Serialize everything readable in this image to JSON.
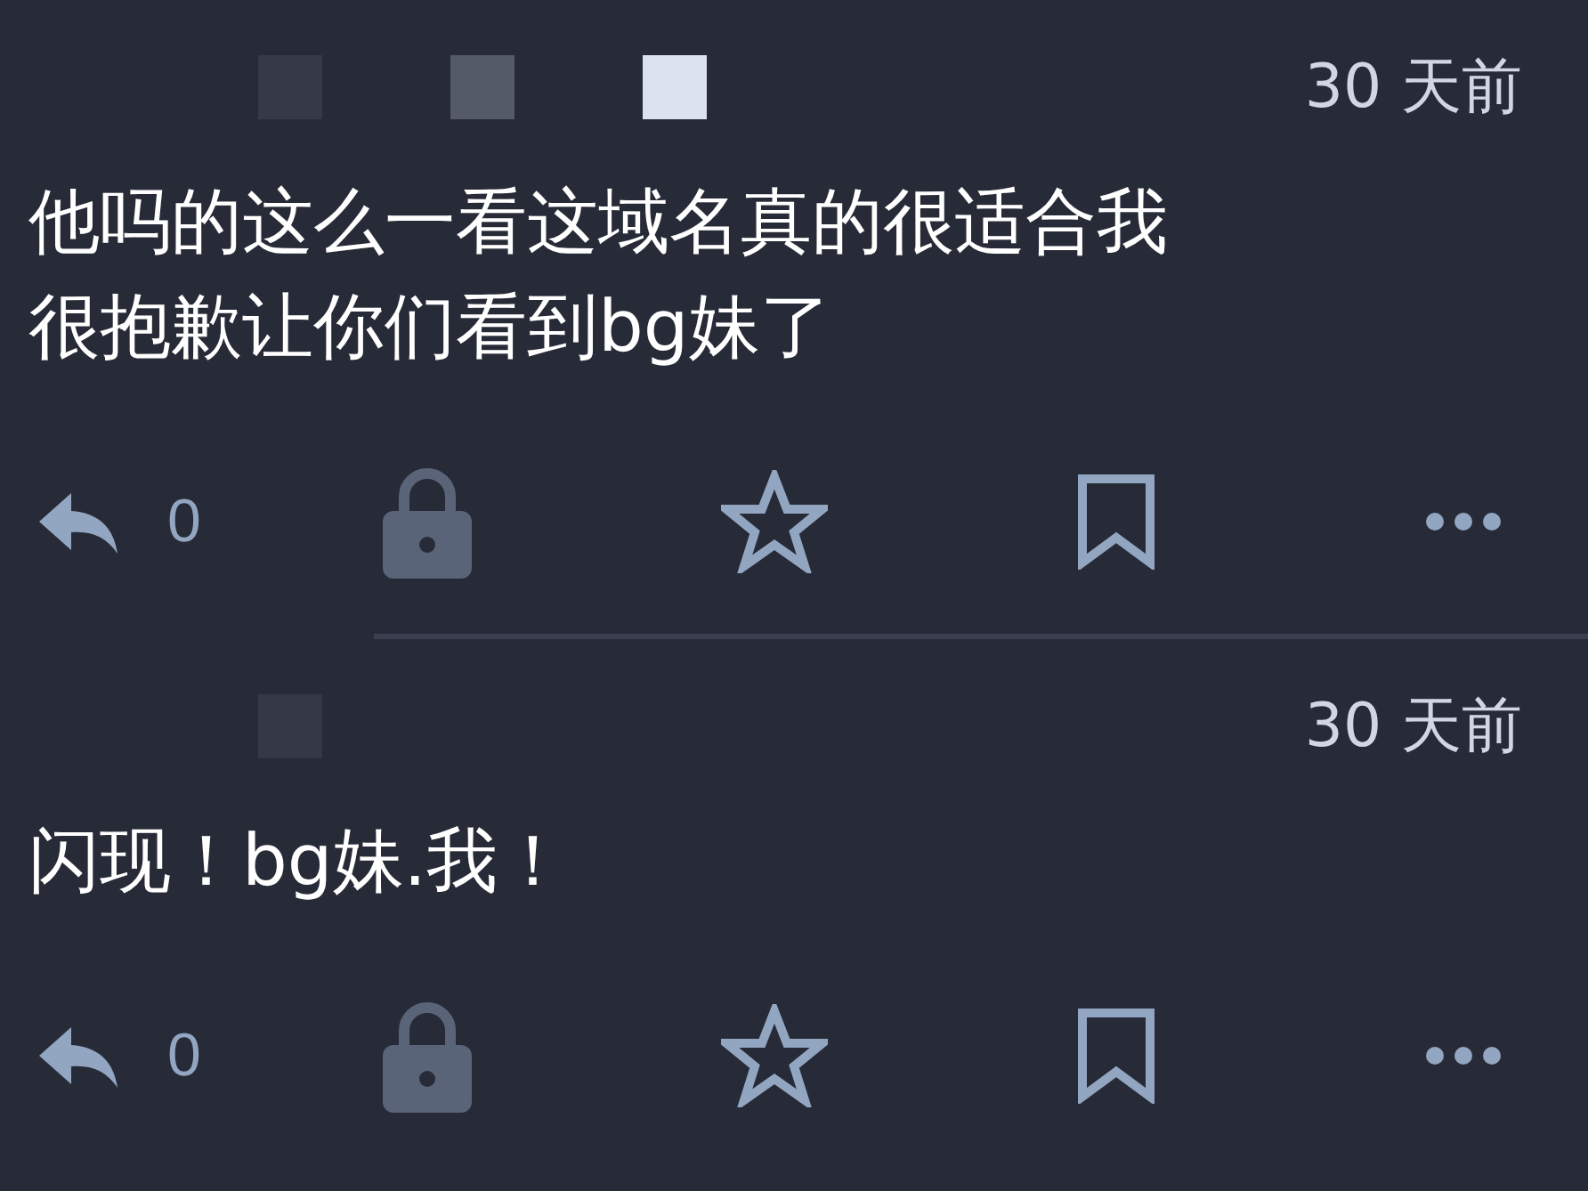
{
  "posts": [
    {
      "redactions": [
        {
          "color": "#363a47"
        },
        {
          "color": "#555a68"
        },
        {
          "color": "#dbe3ee"
        }
      ],
      "time": "30 天前",
      "lines": [
        "他吗的这么一看这域名真的很适合我",
        "很抱歉让你们看到bg妹了"
      ],
      "actions": [
        {
          "kind": "reply",
          "count": "0"
        },
        {
          "kind": "boost",
          "disabled": true
        },
        {
          "kind": "favourite"
        },
        {
          "kind": "bookmark"
        },
        {
          "kind": "more"
        }
      ]
    },
    {
      "redactions": [
        {
          "color": "#353945"
        }
      ],
      "time": "30 天前",
      "lines": [
        "闪现！bg妹.我！"
      ],
      "actions": [
        {
          "kind": "reply",
          "count": "0"
        },
        {
          "kind": "boost",
          "disabled": true
        },
        {
          "kind": "favourite"
        },
        {
          "kind": "bookmark"
        },
        {
          "kind": "more"
        }
      ]
    }
  ]
}
